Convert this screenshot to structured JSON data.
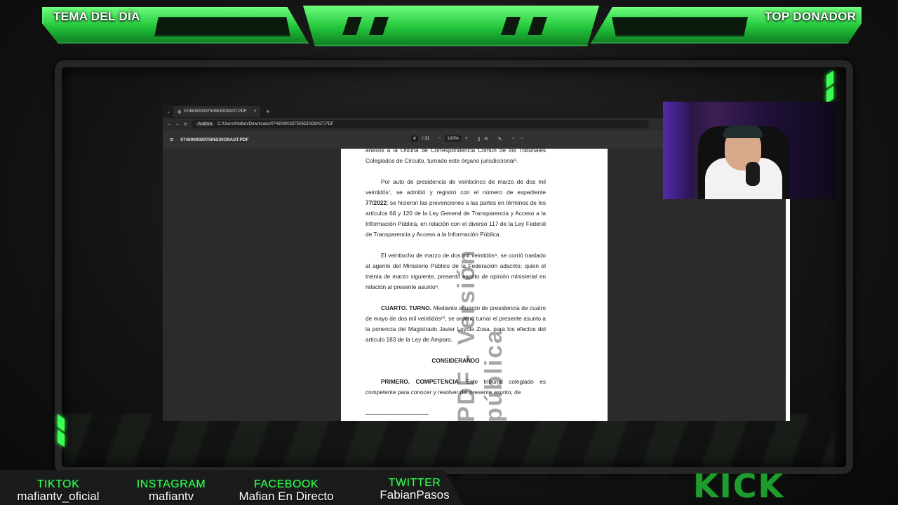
{
  "overlay": {
    "top_left_label": "TEMA DEL DÍA",
    "top_right_label": "TOP DONADOR",
    "kick_logo": "KICK",
    "accent_color": "#2BEA45",
    "socials": [
      {
        "name": "TIKTOK",
        "handle": "mafiantv_oficial"
      },
      {
        "name": "INSTAGRAM",
        "handle": "mafiantv"
      },
      {
        "name": "FACEBOOK",
        "handle": "Mafian En Directo"
      },
      {
        "name": "TWITTER",
        "handle": "FabianPasos"
      }
    ]
  },
  "browser": {
    "tab_title": "07460000297506530O9AST.PDF",
    "new_tab": "+",
    "close_tab": "×",
    "address_badge": "Archivo",
    "address_url": "C:/Users/Mafian/Downloads/07460000297506530O9AST.PDF",
    "pdf_title": "07460000297506530O9AST.PDF",
    "page_current": "4",
    "page_total": "/ 31",
    "zoom": "100%"
  },
  "document": {
    "p0": "anexos a la Oficina de Correspondencia Común de los Tribunales Colegiados de Circuito, turnado este órgano jurisdiccional⁶.",
    "p1": "Por auto de presidencia de veinticinco de marzo de dos mil veintidós⁷, se admitió y registró con el número de expediente",
    "p1_bold": "77/2022",
    "p1_rest": "; se hicieron las prevenciones a las partes en términos de los artículos 68 y 120 de la Ley General de Transparencia y Acceso a la Información Pública, en relación con el diverso 117 de la Ley Federal de Transparencia y Acceso a la Información Pública.",
    "p2": "El veintiocho de marzo de dos mil veintidós⁸, se corrió traslado al agente del Ministerio Público de la Federación adscrito; quien el treinta de marzo siguiente, presentó escrito de opinión ministerial en relación al presente asunto⁹.",
    "p3_bold": "CUARTO. TURNO.",
    "p3": " Mediante acuerdo de presidencia de cuatro de mayo de dos mil veintidós¹⁰, se ordenó turnar el presente asunto a la ponencia del Magistrado Javier Loyola Zosa, para los efectos del artículo 183 de la Ley de Amparo.",
    "heading": "CONSIDERANDO",
    "p4_bold": "PRIMERO. COMPETENCIA.",
    "p4": " Este tribunal colegiado es competente para conocer y resolver del presente asunto, de",
    "watermark": "PDF - Versión pública"
  }
}
